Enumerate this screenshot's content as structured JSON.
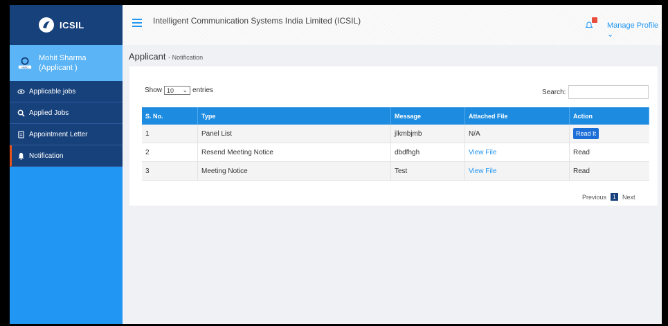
{
  "brand": {
    "name": "ICSIL"
  },
  "user": {
    "name": "Mohit Sharma",
    "role": "(Applicant )"
  },
  "nav": [
    {
      "label": "Applicable jobs",
      "icon": "eye-icon"
    },
    {
      "label": "Applied Jobs",
      "icon": "search-icon"
    },
    {
      "label": "Appointment Letter",
      "icon": "document-icon"
    },
    {
      "label": "Notification",
      "icon": "bell-icon"
    }
  ],
  "header": {
    "title": "Intelligent Communication Systems India Limited (ICSIL)",
    "manage_profile": "Manage Profile ⌄"
  },
  "page": {
    "title": "Applicant",
    "subtitle": "- Notification"
  },
  "table_controls": {
    "show_label": "Show",
    "show_value": "10",
    "entries_label": "entries",
    "search_label": "Search:"
  },
  "table": {
    "columns": [
      "S. No.",
      "Type",
      "Message",
      "Attached File",
      "Action"
    ],
    "rows": [
      {
        "sno": "1",
        "type": "Panel List",
        "message": "jlkmbjmb",
        "file": "N/A",
        "action": "Read It"
      },
      {
        "sno": "2",
        "type": "Resend Meeting Notice",
        "message": "dbdfhgh",
        "file": "View File",
        "action": "Read"
      },
      {
        "sno": "3",
        "type": "Meeting Notice",
        "message": "Test",
        "file": "View File",
        "action": "Read"
      }
    ]
  },
  "pagination": {
    "previous": "Previous",
    "current": "1",
    "next": "Next"
  },
  "colors": {
    "sidebar": "#2196f3",
    "sidebar_dark": "#17417b",
    "accent": "#e8531b",
    "table_header": "#1d8ce0"
  }
}
